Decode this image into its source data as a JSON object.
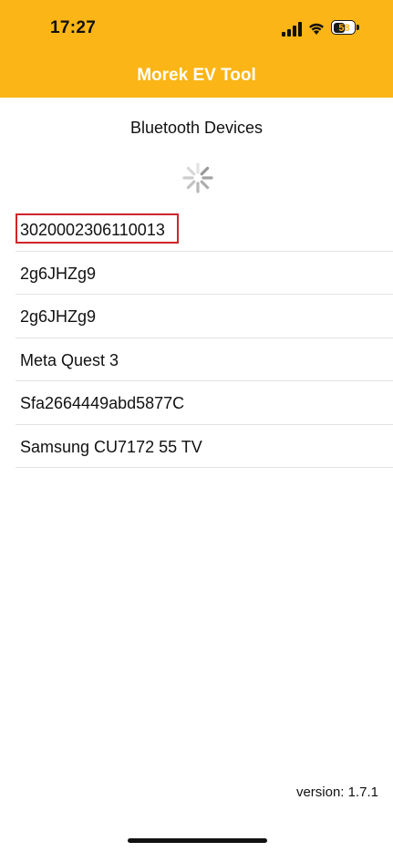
{
  "status_bar": {
    "time": "17:27",
    "battery_level": "58",
    "battery_fraction": 0.58,
    "icons": [
      "cellular-signal-icon",
      "wifi-icon",
      "battery-icon"
    ]
  },
  "header": {
    "title": "Morek EV Tool",
    "background_color": "#FBB516"
  },
  "main": {
    "section_title": "Bluetooth Devices",
    "loading_indicator": "spinner-icon",
    "devices": [
      {
        "name": "3020002306110013",
        "highlighted": true
      },
      {
        "name": "2g6JHZg9",
        "highlighted": false
      },
      {
        "name": "2g6JHZg9",
        "highlighted": false
      },
      {
        "name": "Meta Quest 3",
        "highlighted": false
      },
      {
        "name": "Sfa2664449abd5877C",
        "highlighted": false
      },
      {
        "name": "Samsung CU7172 55 TV",
        "highlighted": false
      }
    ],
    "highlight_color": "#D0242B"
  },
  "footer": {
    "version": "version: 1.7.1"
  }
}
